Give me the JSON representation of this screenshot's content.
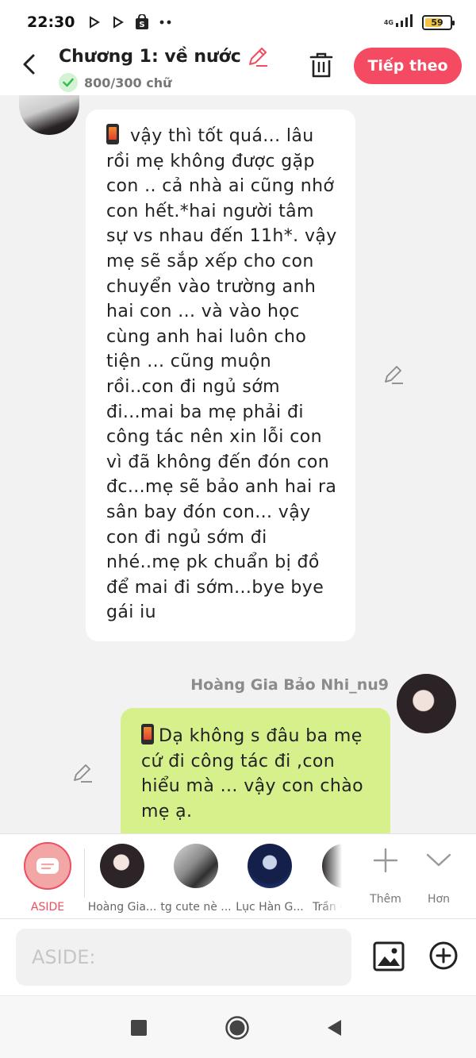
{
  "status_bar": {
    "time": "22:30",
    "network": "4G",
    "battery": "59",
    "battery_level": 0.59,
    "notification_icons": [
      "play-arrow-icon",
      "play-arrow-icon",
      "shop-icon",
      "more-dots-icon"
    ]
  },
  "header": {
    "title": "Chương 1: về nước",
    "word_count": "800/300 chữ",
    "next_label": "Tiếp theo"
  },
  "messages": [
    {
      "side": "left",
      "text": "vậy thì tốt quá... lâu rồi mẹ không được gặp con .. cả nhà ai cũng nhớ con hết.*hai người tâm sự vs nhau đến 11h*. vậy mẹ sẽ sắp xếp cho con chuyển vào trường anh hai con ... và vào học cùng anh hai luôn cho tiện ... cũng muộn rồi..con đi ngủ sớm đi...mai  ba mẹ phải đi công tác nên xin lỗi con vì đã không đến đón con đc...mẹ sẽ bảo anh hai ra sân bay đón con... vậy con đi ngủ sớm đi nhé..mẹ pk chuẩn bị đồ để mai đi sớm...bye bye gái iu"
    },
    {
      "side": "right",
      "sender": "Hoàng Gia Bảo Nhi_nu9",
      "text": "Dạ không s đâu ba mẹ cứ đi công tác đi ,con hiểu mà ... vậy con chào mẹ ạ."
    }
  ],
  "characters": [
    {
      "label": "ASIDE",
      "selected": true
    },
    {
      "label": "Hoàng Gia..."
    },
    {
      "label": "tg cute nè ..."
    },
    {
      "label": "Lục Hàn G..."
    },
    {
      "label": "Trần Q"
    }
  ],
  "tools": [
    {
      "label": "Thêm",
      "icon": "plus-icon"
    },
    {
      "label": "Hơn",
      "icon": "chevron-down-icon"
    }
  ],
  "input": {
    "placeholder": "ASIDE:"
  },
  "colors": {
    "accent": "#f44b62",
    "bubble_right": "#d6f18c",
    "bubble_left": "#ffffff",
    "background": "#f2f2f2"
  }
}
